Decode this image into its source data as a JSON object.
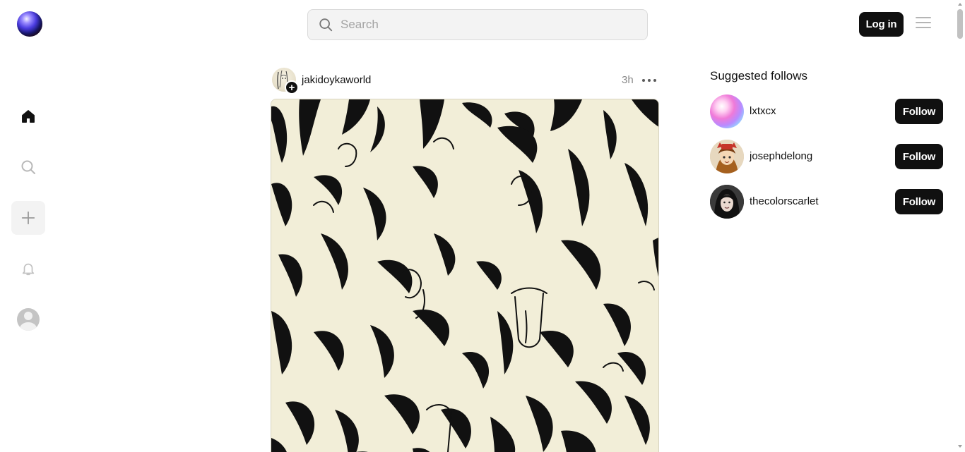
{
  "header": {
    "logo_icon": "app-logo-orb",
    "search": {
      "placeholder": "Search",
      "value": ""
    },
    "login_label": "Log in",
    "menu_icon": "hamburger-icon"
  },
  "sidebar": {
    "items": [
      {
        "name": "home",
        "icon": "home-icon",
        "active": true
      },
      {
        "name": "search",
        "icon": "search-icon",
        "active": false
      },
      {
        "name": "create",
        "icon": "plus-icon",
        "active": false
      },
      {
        "name": "notifications",
        "icon": "bell-icon",
        "active": false
      },
      {
        "name": "profile",
        "icon": "avatar-icon",
        "active": false
      }
    ]
  },
  "post": {
    "username": "jakidoykaworld",
    "time": "3h",
    "follow_badge": "+",
    "more_icon": "more-icon",
    "media_icon": "ink-drawing-image"
  },
  "suggested": {
    "title": "Suggested follows",
    "users": [
      {
        "name": "lxtxcx",
        "button": "Follow"
      },
      {
        "name": "josephdelong",
        "button": "Follow"
      },
      {
        "name": "thecolorscarlet",
        "button": "Follow"
      }
    ]
  },
  "colors": {
    "button_bg": "#101010",
    "search_bg": "#f3f3f3",
    "muted_text": "#8a8a8a",
    "canvas_paper": "#f2eed8"
  }
}
